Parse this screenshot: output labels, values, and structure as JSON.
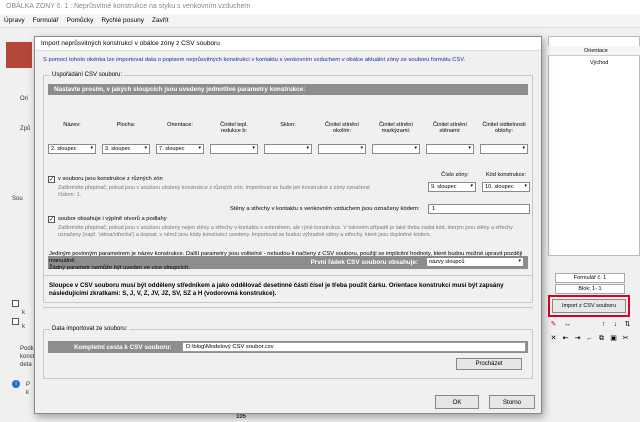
{
  "app": {
    "title": "OBÁLKA ZÓNY č. 1 : Neprůsvitné konstrukce na styku s venkovním vzduchem",
    "menu": [
      "Úpravy",
      "Formulář",
      "Pomůcky",
      "Rychlé posuny",
      "Zavřít"
    ],
    "left_labels": [
      "Ori",
      "Způ",
      "Sou",
      "k",
      "k",
      "Podk",
      "konst",
      "deta",
      "P",
      "k"
    ],
    "right_headers": [
      "Orientace",
      "Východ"
    ],
    "formular": "Formulář č. 1",
    "blok": "Blok: 1- 1",
    "import_button": "Import z CSV souboru",
    "bottom_frag": "105"
  },
  "dialog": {
    "title": "Import neprůsvitných konstrukcí v obálce zóny z CSV souboru",
    "description": "S pomocí tohoto okénka lze importovat data o popisem neprůsvitných konstrukcí v kontaktu s venkovním vzduchem v obálce aktuální zóny ze souboru formátu CSV.",
    "group1_label": "Uspořádání CSV souboru:",
    "bar1": "Nastavte prosím, v jakých sloupcích jsou uvedeny jednotlivé parametry konstrukce:",
    "columns": [
      {
        "label": "Název:",
        "value": "2. sloupec"
      },
      {
        "label": "Plocha:",
        "value": "3. sloupec"
      },
      {
        "label": "Orientace:",
        "value": "7. sloupec"
      },
      {
        "label": "Činitel tepl. redukce b:",
        "value": ""
      },
      {
        "label": "Sklon:",
        "value": ""
      },
      {
        "label": "Činitel stínění okolím:",
        "value": ""
      },
      {
        "label": "Činitel stínění markýzami:",
        "value": ""
      },
      {
        "label": "Činitel stínění stěnami:",
        "value": ""
      },
      {
        "label": "Činitel viditelnosti oblohy:",
        "value": ""
      }
    ],
    "check1": "v souboru jsou konstrukce z různých zón",
    "check1_desc": "Zaškrtněte přepínač, pokud jsou v souboru uloženy konstrukce z různých zón. Importovat se bude jen konstrukce z zóny označené číslem: 1.",
    "zone_label": "Číslo zóny:",
    "zone_value": "9. sloupec",
    "code_label": "Kód konstrukce:",
    "code_value": "10. sloupec",
    "walls_label": "Stěny a střechy v kontaktu s venkovním vzduchem jsou označeny kódem:",
    "walls_value": "1",
    "check2": "soubor obsahuje i výplně otvorů a podlahy",
    "check2_desc": "Zaškrtněte přepínač, pokud jsou v souboru uloženy nejen stěny a střechy v kontaktu s exteriérem, ale i jiné konstrukce. V takovém případě je také třeba zadat kód, kterým jsou stěny a střechy označeny (např. 'stěna/střecha') a dopsat, v němž jsou kódy konstrukcí uvedeny. Importovat se budou výhradně stěny a střechy, které jsou doplněné kódem.",
    "first_row_label": "První řádek CSV souboru obsahuje:",
    "first_row_value": "názvy sloupců",
    "info1a": "Jediným povinným parametrem je název konstrukce. Další parametry jsou volitelné - nebudou-li načteny z CSV souboru, použijí se implicitní hodnoty, které budou možné upravit později manuálně.",
    "info1b": "Žádný parametr nemůže být uveden ve více sloupcích.",
    "info2": "Sloupce v CSV souboru musí být odděleny středníkem a jako oddělovač desetinné části čísel je třeba použít čárku. Orientace konstrukcí musí být zapsány následujícími zkratkami: S, J, V, Z, JV, JZ, SV, SZ a H (vodorovná konstrukce).",
    "group2_label": "Data importovat ze souboru:",
    "path_label": "Kompletní cesta k CSV souboru:",
    "path_value": "D:\\blog\\Modelový CSV soubor.csv",
    "browse": "Procházet",
    "ok": "OK",
    "cancel": "Storno"
  }
}
